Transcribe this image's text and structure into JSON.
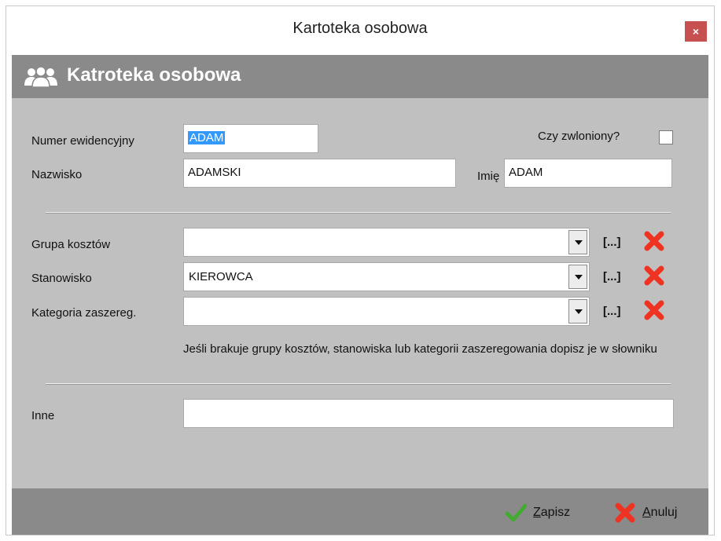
{
  "window": {
    "title": "Kartoteka osobowa",
    "close_glyph": "×"
  },
  "header": {
    "icon": "people-group-icon",
    "title": "Katroteka osobowa"
  },
  "form": {
    "numer_label": "Numer ewidencyjny",
    "numer_value": "ADAM",
    "zwolniony_label": "Czy zwloniony?",
    "zwolniony_checked": false,
    "nazwisko_label": "Nazwisko",
    "nazwisko_value": "ADAMSKI",
    "imie_label": "Imię",
    "imie_value": "ADAM",
    "grupa_label": "Grupa kosztów",
    "grupa_value": "",
    "stanowisko_label": "Stanowisko",
    "stanowisko_value": "KIEROWCA",
    "kategoria_label": "Kategoria zaszereg.",
    "kategoria_value": "",
    "browse_label": "[...]",
    "note": "Jeśli brakuje grupy kosztów, stanowiska lub kategorii zaszeregowania dopisz je w słowniku",
    "inne_label": "Inne",
    "inne_value": ""
  },
  "footer": {
    "save_first": "Z",
    "save_rest": "apisz",
    "cancel_first": "A",
    "cancel_rest": "nuluj"
  },
  "colors": {
    "header_bg": "#8a8a8a",
    "body_bg": "#c0c0c0",
    "close_bg": "#c75050",
    "clear_red": "#ee3322",
    "save_green": "#44aa33",
    "selection": "#3399ff"
  }
}
